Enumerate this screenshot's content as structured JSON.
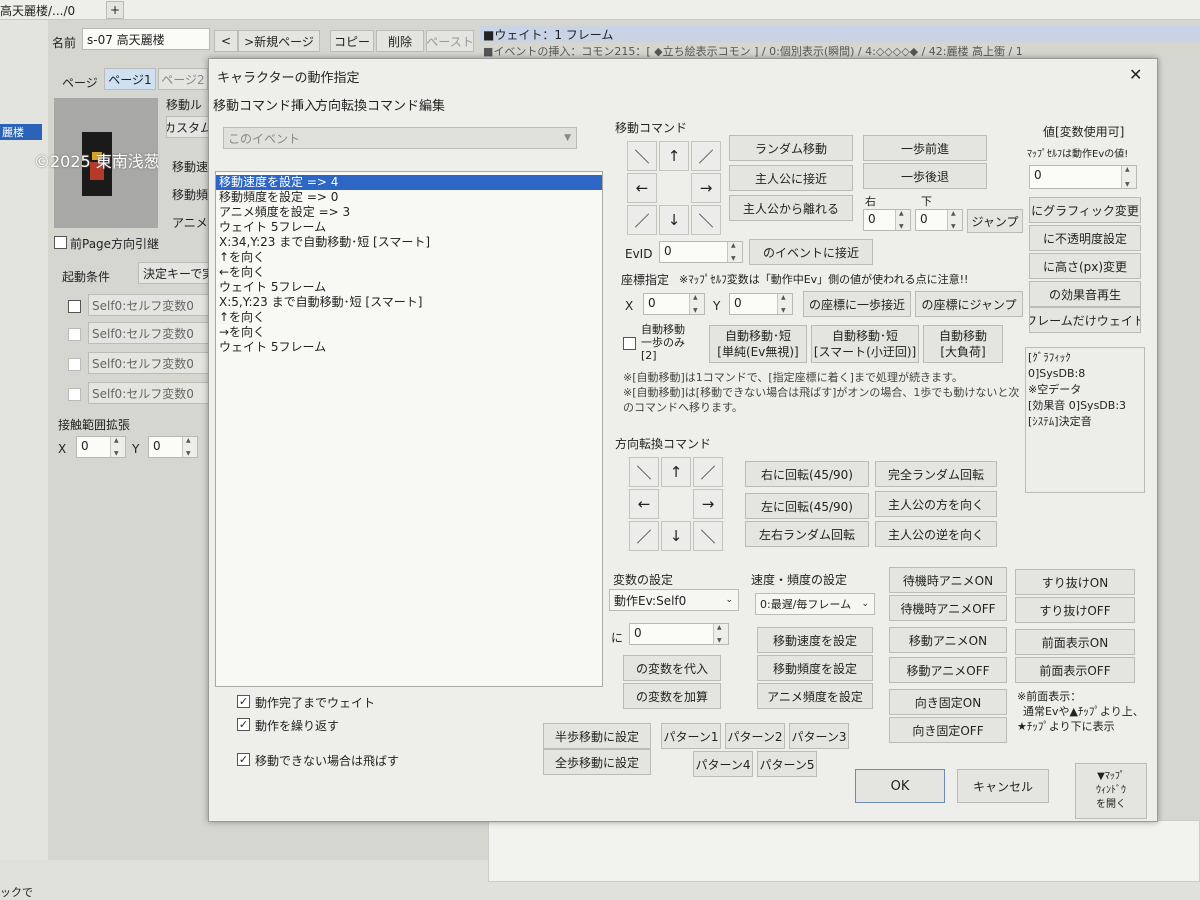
{
  "bg": {
    "tab_title": "高天麗楼/.../0",
    "tab_plus": "+",
    "name_label": "名前",
    "name_value": "s-07 高天麗楼",
    "prev_btn": "<",
    "new_page_btn": ">新規ページ",
    "copy_btn": "コピー",
    "delete_btn": "削除",
    "paste_btn": "ペースト",
    "right_line1": "■ウェイト：1 フレーム",
    "right_line2": "■イベントの挿入：コモン215：[ ◆立ち絵表示コモン ] / 0:個別表示(瞬間) / 4:◇◇◇◇◆ / 42:麗楼 高上衝 / 1",
    "left_sel_item": "麗楼",
    "page_label": "ページ",
    "page_tab1": "ページ1",
    "page_tab2": "ページ2",
    "move_label": "移動ル",
    "custom_btn": "カスタム",
    "move_speed_label": "移動速",
    "move_freq_label": "移動頻",
    "anim_freq_label": "アニメ頻",
    "watermark": "©2025 東南浅葱",
    "prev_page_dir": "前Page方向引継",
    "start_cond_label": "起動条件",
    "start_cond_value": "決定キーで実",
    "self_vars": [
      "Self0:セルフ変数0",
      "Self0:セルフ変数0",
      "Self0:セルフ変数0",
      "Self0:セルフ変数0"
    ],
    "contact_label": "接触範囲拡張",
    "x_label": "X",
    "x_value": "0",
    "y_label": "Y",
    "y_value": "0",
    "status_text": "ックで"
  },
  "dialog": {
    "title": "キャラクターの動作指定",
    "close": "✕",
    "menu": [
      "移動コマンド挿入",
      "方向転換コマンド",
      "編集"
    ],
    "target_select": "このイベント",
    "list_items": [
      "移動速度を設定 => 4",
      "移動頻度を設定 => 0",
      "アニメ頻度を設定 => 3",
      "ウェイト 5フレーム",
      " X:34,Y:23 まで自動移動･短 [スマート]",
      "↑を向く",
      "←を向く",
      "ウェイト 5フレーム",
      " X:5,Y:23 まで自動移動･短 [スマート]",
      "↑を向く",
      "→を向く",
      "ウェイト 5フレーム"
    ],
    "selected_index": 0,
    "chk_wait": "動作完了までウェイト",
    "chk_repeat": "動作を繰り返す",
    "chk_skip": "移動できない場合は飛ばす",
    "move_cmd_label": "移動コマンド",
    "arrows": [
      "＼",
      "↑",
      "／",
      "←",
      "",
      "→",
      "／",
      "↓",
      "＼"
    ],
    "random_move": "ランダム移動",
    "approach_hero": "主人公に接近",
    "away_hero": "主人公から離れる",
    "step_forward": "一歩前進",
    "step_back": "一歩後退",
    "right_label": "右",
    "down_label": "下",
    "right_value": "0",
    "down_value": "0",
    "jump_btn": "ジャンプ",
    "evid_label": "EvID",
    "evid_value": "0",
    "approach_event": "のイベントに接近",
    "coord_label": "座標指定",
    "coord_note": "※ﾏｯﾌﾟｾﾙﾌ変数は「動作中Ev」側の値が使われる点に注意!!",
    "cx_label": "X",
    "cx_value": "0",
    "cy_label": "Y",
    "cy_value": "0",
    "coord_step": "の座標に一歩接近",
    "coord_jump": "の座標にジャンプ",
    "auto_step_chk": [
      "自動移動",
      "一歩のみ",
      "[2]"
    ],
    "auto_short1": [
      "自動移動･短",
      "[単純(Ev無視)]"
    ],
    "auto_short2": [
      "自動移動･短",
      "[スマート(小迂回)]"
    ],
    "auto_full": [
      "自動移動",
      "[大負荷]"
    ],
    "note1": "※[自動移動]は1コマンドで、[指定座標に着く]まで処理が続きます。",
    "note2": "※[自動移動]は[移動できない場合は飛ばす]がオンの場合、1歩でも動けないと次のコマンドへ移ります。",
    "dir_cmd_label": "方向転換コマンド",
    "dir_arrows": [
      "＼",
      "↑",
      "／",
      "←",
      "",
      "→",
      "／",
      "↓",
      "＼"
    ],
    "turn_right": "右に回転(45/90)",
    "turn_left": "左に回転(45/90)",
    "turn_random_lr": "左右ランダム回転",
    "full_random": "完全ランダム回転",
    "face_hero": "主人公の方を向く",
    "face_away": "主人公の逆を向く",
    "value_title": "値[変数使用可]",
    "value_note": "ﾏｯﾌﾟｾﾙﾌは動作Evの値!",
    "value_input": "0",
    "graphic_change": "にグラフィック変更",
    "opacity_change": "に不透明度設定",
    "height_change": "に高さ(px)変更",
    "sound_play": "の効果音再生",
    "frame_wait": "フレームだけウェイト",
    "info_lines": [
      "[ｸﾞﾗﾌｨｯｸ",
      "0]SysDB:8",
      "※空データ",
      "[効果音 0]SysDB:3",
      "[ｼｽﾃﾑ]決定音"
    ],
    "var_label": "変数の設定",
    "var_select": "動作Ev:Self0",
    "ni_label": "に",
    "var_value": "0",
    "assign_btn": "の変数を代入",
    "add_btn": "の変数を加算",
    "speed_label": "速度・頻度の設定",
    "speed_select": "0:最遅/毎フレーム",
    "set_speed": "移動速度を設定",
    "set_freq": "移動頻度を設定",
    "set_anim": "アニメ頻度を設定",
    "idle_on": "待機時アニメON",
    "idle_off": "待機時アニメOFF",
    "move_anim_on": "移動アニメON",
    "move_anim_off": "移動アニメOFF",
    "dir_fix_on": "向き固定ON",
    "dir_fix_off": "向き固定OFF",
    "pass_on": "すり抜けON",
    "pass_off": "すり抜けOFF",
    "front_on": "前面表示ON",
    "front_off": "前面表示OFF",
    "front_note": [
      "※前面表示：",
      "通常Evや▲ﾁｯﾌﾟより上、",
      "★ﾁｯﾌﾟより下に表示"
    ],
    "half_step": "半歩移動に設定",
    "full_step": "全歩移動に設定",
    "patterns": [
      "パターン1",
      "パターン2",
      "パターン3",
      "パターン4",
      "パターン5"
    ],
    "ok": "OK",
    "cancel": "キャンセル",
    "map_window": [
      "▼ﾏｯﾌﾟ",
      "ｳｨﾝﾄﾞｳ",
      "を開く"
    ]
  }
}
